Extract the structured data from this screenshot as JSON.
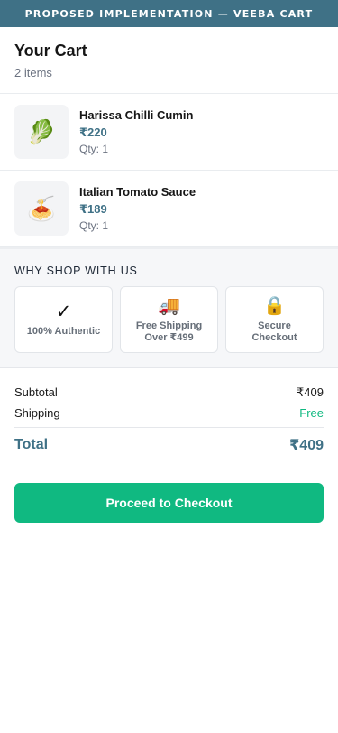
{
  "banner": {
    "text": "PROPOSED IMPLEMENTATION — VEEBA CART"
  },
  "header": {
    "title": "Your Cart",
    "count": "2 items"
  },
  "cart": {
    "items": [
      {
        "name": "Harissa Chilli Cumin",
        "price": "₹220",
        "qty": "Qty: 1",
        "icon": "🥬",
        "icon_name": "leafy-greens-icon"
      },
      {
        "name": "Italian Tomato Sauce",
        "price": "₹189",
        "qty": "Qty: 1",
        "icon": "🍝",
        "icon_name": "spaghetti-icon"
      }
    ]
  },
  "why": {
    "title": "WHY SHOP WITH US",
    "features": [
      {
        "icon": "✓",
        "icon_name": "checkmark-icon",
        "label": "100% Authentic"
      },
      {
        "icon": "🚚",
        "icon_name": "delivery-truck-icon",
        "label": "Free Shipping\nOver ₹499"
      },
      {
        "icon": "🔒",
        "icon_name": "lock-icon",
        "label": "Secure\nCheckout"
      }
    ]
  },
  "summary": {
    "subtotal_label": "Subtotal",
    "subtotal_value": "₹409",
    "shipping_label": "Shipping",
    "shipping_value": "Free",
    "total_label": "Total",
    "total_value": "₹409"
  },
  "checkout": {
    "label": "Proceed to Checkout"
  },
  "colors": {
    "brand": "#3f7186",
    "accent": "#10b981",
    "muted": "#6b7280"
  }
}
